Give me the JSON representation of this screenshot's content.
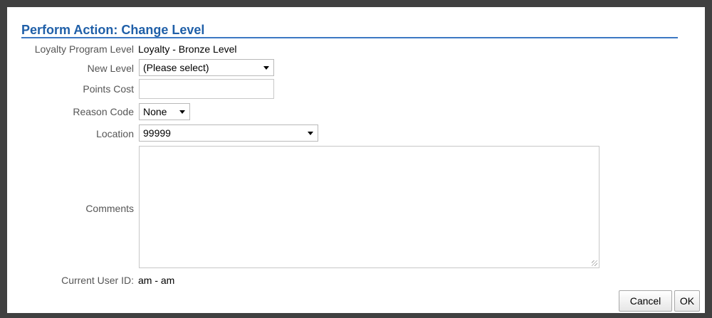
{
  "dialog": {
    "title": "Perform Action: Change Level"
  },
  "form": {
    "loyalty_program_level": {
      "label": "Loyalty Program Level",
      "value": "Loyalty - Bronze Level"
    },
    "new_level": {
      "label": "New Level",
      "selected": "(Please select)"
    },
    "points_cost": {
      "label": "Points Cost",
      "value": ""
    },
    "reason_code": {
      "label": "Reason Code",
      "selected": "None"
    },
    "location": {
      "label": "Location",
      "selected": "99999"
    },
    "comments": {
      "label": "Comments",
      "value": ""
    },
    "current_user_id": {
      "label": "Current User ID:",
      "value": "am - am"
    }
  },
  "buttons": {
    "cancel": "Cancel",
    "ok": "OK"
  },
  "colors": {
    "title": "#1f5fa8",
    "title_rule": "#3c78c3",
    "backdrop": "#404040"
  }
}
